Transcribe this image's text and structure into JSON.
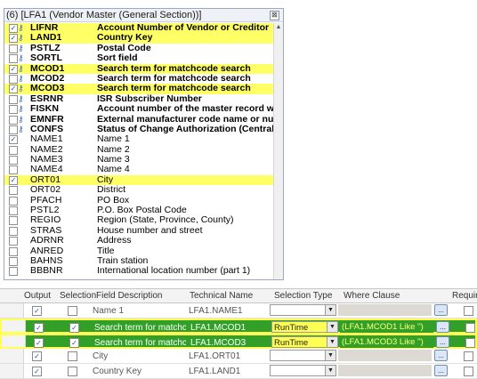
{
  "panel": {
    "title": "(6) [LFA1 (Vendor Master (General Section))]",
    "close_glyph": "⊠",
    "rows": [
      {
        "checked": true,
        "key": true,
        "name": "LIFNR",
        "desc": "Account Number of Vendor or Creditor",
        "hl": true
      },
      {
        "checked": true,
        "key": true,
        "name": "LAND1",
        "desc": "Country Key",
        "hl": true
      },
      {
        "checked": false,
        "key": true,
        "name": "PSTLZ",
        "desc": "Postal Code",
        "hl": false
      },
      {
        "checked": false,
        "key": true,
        "name": "SORTL",
        "desc": "Sort field",
        "hl": false
      },
      {
        "checked": true,
        "key": true,
        "name": "MCOD1",
        "desc": "Search term for matchcode search",
        "hl": true
      },
      {
        "checked": false,
        "key": true,
        "name": "MCOD2",
        "desc": "Search term for matchcode search",
        "hl": false
      },
      {
        "checked": true,
        "key": true,
        "name": "MCOD3",
        "desc": "Search term for matchcode search",
        "hl": true
      },
      {
        "checked": false,
        "key": true,
        "name": "ESRNR",
        "desc": "ISR Subscriber Number",
        "hl": false
      },
      {
        "checked": false,
        "key": true,
        "name": "FISKN",
        "desc": "Account number of the master record wit",
        "hl": false
      },
      {
        "checked": false,
        "key": true,
        "name": "EMNFR",
        "desc": "External manufacturer code name or num",
        "hl": false
      },
      {
        "checked": false,
        "key": true,
        "name": "CONFS",
        "desc": "Status of Change Authorization (Central)",
        "hl": false
      },
      {
        "checked": true,
        "key": false,
        "name": "NAME1",
        "desc": "Name 1",
        "hl": false
      },
      {
        "checked": false,
        "key": false,
        "name": "NAME2",
        "desc": "Name 2",
        "hl": false
      },
      {
        "checked": false,
        "key": false,
        "name": "NAME3",
        "desc": "Name 3",
        "hl": false
      },
      {
        "checked": false,
        "key": false,
        "name": "NAME4",
        "desc": "Name 4",
        "hl": false
      },
      {
        "checked": true,
        "key": false,
        "name": "ORT01",
        "desc": "City",
        "hl": true
      },
      {
        "checked": false,
        "key": false,
        "name": "ORT02",
        "desc": "District",
        "hl": false
      },
      {
        "checked": false,
        "key": false,
        "name": "PFACH",
        "desc": "PO Box",
        "hl": false
      },
      {
        "checked": false,
        "key": false,
        "name": "PSTL2",
        "desc": "P.O. Box Postal Code",
        "hl": false
      },
      {
        "checked": false,
        "key": false,
        "name": "REGIO",
        "desc": "Region (State, Province, County)",
        "hl": false
      },
      {
        "checked": false,
        "key": false,
        "name": "STRAS",
        "desc": "House number and street",
        "hl": false
      },
      {
        "checked": false,
        "key": false,
        "name": "ADRNR",
        "desc": "Address",
        "hl": false
      },
      {
        "checked": false,
        "key": false,
        "name": "ANRED",
        "desc": "Title",
        "hl": false
      },
      {
        "checked": false,
        "key": false,
        "name": "BAHNS",
        "desc": "Train station",
        "hl": false
      },
      {
        "checked": false,
        "key": false,
        "name": "BBBNR",
        "desc": "International location number  (part 1)",
        "hl": false
      }
    ]
  },
  "grid": {
    "headers": {
      "output": "Output",
      "selection": "Selection",
      "field_description": "Field Description",
      "technical_name": "Technical Name",
      "selection_type": "Selection Type",
      "where_clause": "Where Clause",
      "required": "Requir"
    },
    "rows": [
      {
        "output": true,
        "selection": false,
        "desc": "Name 1",
        "tech": "LFA1.NAME1",
        "seltype": "",
        "where": "",
        "hl": false
      },
      {
        "output": true,
        "selection": true,
        "desc": "Search term for matchco...",
        "tech": "LFA1.MCOD1",
        "seltype": "RunTime",
        "where": "(LFA1.MCOD1 Like '')",
        "hl": true
      },
      {
        "output": true,
        "selection": true,
        "desc": "Search term for matchco...",
        "tech": "LFA1.MCOD3",
        "seltype": "RunTime",
        "where": "(LFA1.MCOD3 Like '')",
        "hl": true
      },
      {
        "output": true,
        "selection": false,
        "desc": "City",
        "tech": "LFA1.ORT01",
        "seltype": "",
        "where": "",
        "hl": false
      },
      {
        "output": true,
        "selection": false,
        "desc": "Country Key",
        "tech": "LFA1.LAND1",
        "seltype": "",
        "where": "",
        "hl": false
      }
    ],
    "dots_label": "...",
    "dropdown_glyph": "▼"
  },
  "colors": {
    "highlight_yellow": "#ffff66",
    "highlight_green": "#32a028",
    "panel_border": "#9aa9bf"
  },
  "icons": {
    "key": "key-icon",
    "check": "checkmark-icon",
    "dropdown": "chevron-down-icon"
  }
}
